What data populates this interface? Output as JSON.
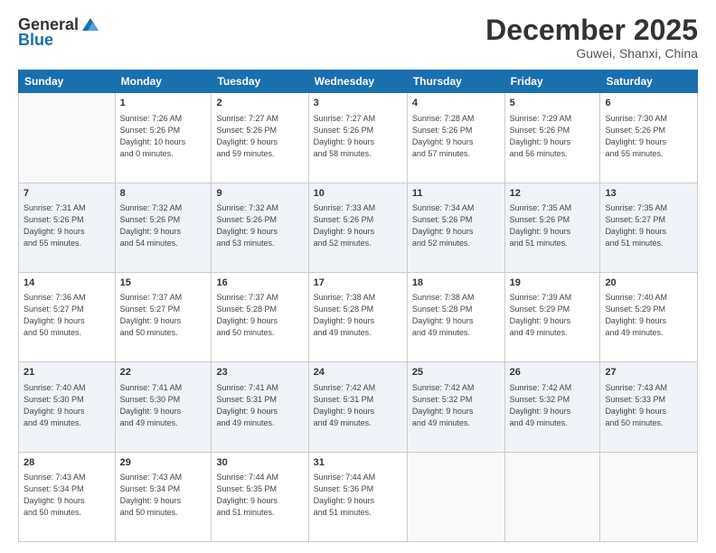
{
  "logo": {
    "text1": "General",
    "text2": "Blue"
  },
  "header": {
    "month": "December 2025",
    "location": "Guwei, Shanxi, China"
  },
  "weekdays": [
    "Sunday",
    "Monday",
    "Tuesday",
    "Wednesday",
    "Thursday",
    "Friday",
    "Saturday"
  ],
  "weeks": [
    [
      {
        "day": "",
        "info": ""
      },
      {
        "day": "1",
        "info": "Sunrise: 7:26 AM\nSunset: 5:26 PM\nDaylight: 10 hours\nand 0 minutes."
      },
      {
        "day": "2",
        "info": "Sunrise: 7:27 AM\nSunset: 5:26 PM\nDaylight: 9 hours\nand 59 minutes."
      },
      {
        "day": "3",
        "info": "Sunrise: 7:27 AM\nSunset: 5:26 PM\nDaylight: 9 hours\nand 58 minutes."
      },
      {
        "day": "4",
        "info": "Sunrise: 7:28 AM\nSunset: 5:26 PM\nDaylight: 9 hours\nand 57 minutes."
      },
      {
        "day": "5",
        "info": "Sunrise: 7:29 AM\nSunset: 5:26 PM\nDaylight: 9 hours\nand 56 minutes."
      },
      {
        "day": "6",
        "info": "Sunrise: 7:30 AM\nSunset: 5:26 PM\nDaylight: 9 hours\nand 55 minutes."
      }
    ],
    [
      {
        "day": "7",
        "info": "Sunrise: 7:31 AM\nSunset: 5:26 PM\nDaylight: 9 hours\nand 55 minutes."
      },
      {
        "day": "8",
        "info": "Sunrise: 7:32 AM\nSunset: 5:26 PM\nDaylight: 9 hours\nand 54 minutes."
      },
      {
        "day": "9",
        "info": "Sunrise: 7:32 AM\nSunset: 5:26 PM\nDaylight: 9 hours\nand 53 minutes."
      },
      {
        "day": "10",
        "info": "Sunrise: 7:33 AM\nSunset: 5:26 PM\nDaylight: 9 hours\nand 52 minutes."
      },
      {
        "day": "11",
        "info": "Sunrise: 7:34 AM\nSunset: 5:26 PM\nDaylight: 9 hours\nand 52 minutes."
      },
      {
        "day": "12",
        "info": "Sunrise: 7:35 AM\nSunset: 5:26 PM\nDaylight: 9 hours\nand 51 minutes."
      },
      {
        "day": "13",
        "info": "Sunrise: 7:35 AM\nSunset: 5:27 PM\nDaylight: 9 hours\nand 51 minutes."
      }
    ],
    [
      {
        "day": "14",
        "info": "Sunrise: 7:36 AM\nSunset: 5:27 PM\nDaylight: 9 hours\nand 50 minutes."
      },
      {
        "day": "15",
        "info": "Sunrise: 7:37 AM\nSunset: 5:27 PM\nDaylight: 9 hours\nand 50 minutes."
      },
      {
        "day": "16",
        "info": "Sunrise: 7:37 AM\nSunset: 5:28 PM\nDaylight: 9 hours\nand 50 minutes."
      },
      {
        "day": "17",
        "info": "Sunrise: 7:38 AM\nSunset: 5:28 PM\nDaylight: 9 hours\nand 49 minutes."
      },
      {
        "day": "18",
        "info": "Sunrise: 7:38 AM\nSunset: 5:28 PM\nDaylight: 9 hours\nand 49 minutes."
      },
      {
        "day": "19",
        "info": "Sunrise: 7:39 AM\nSunset: 5:29 PM\nDaylight: 9 hours\nand 49 minutes."
      },
      {
        "day": "20",
        "info": "Sunrise: 7:40 AM\nSunset: 5:29 PM\nDaylight: 9 hours\nand 49 minutes."
      }
    ],
    [
      {
        "day": "21",
        "info": "Sunrise: 7:40 AM\nSunset: 5:30 PM\nDaylight: 9 hours\nand 49 minutes."
      },
      {
        "day": "22",
        "info": "Sunrise: 7:41 AM\nSunset: 5:30 PM\nDaylight: 9 hours\nand 49 minutes."
      },
      {
        "day": "23",
        "info": "Sunrise: 7:41 AM\nSunset: 5:31 PM\nDaylight: 9 hours\nand 49 minutes."
      },
      {
        "day": "24",
        "info": "Sunrise: 7:42 AM\nSunset: 5:31 PM\nDaylight: 9 hours\nand 49 minutes."
      },
      {
        "day": "25",
        "info": "Sunrise: 7:42 AM\nSunset: 5:32 PM\nDaylight: 9 hours\nand 49 minutes."
      },
      {
        "day": "26",
        "info": "Sunrise: 7:42 AM\nSunset: 5:32 PM\nDaylight: 9 hours\nand 49 minutes."
      },
      {
        "day": "27",
        "info": "Sunrise: 7:43 AM\nSunset: 5:33 PM\nDaylight: 9 hours\nand 50 minutes."
      }
    ],
    [
      {
        "day": "28",
        "info": "Sunrise: 7:43 AM\nSunset: 5:34 PM\nDaylight: 9 hours\nand 50 minutes."
      },
      {
        "day": "29",
        "info": "Sunrise: 7:43 AM\nSunset: 5:34 PM\nDaylight: 9 hours\nand 50 minutes."
      },
      {
        "day": "30",
        "info": "Sunrise: 7:44 AM\nSunset: 5:35 PM\nDaylight: 9 hours\nand 51 minutes."
      },
      {
        "day": "31",
        "info": "Sunrise: 7:44 AM\nSunset: 5:36 PM\nDaylight: 9 hours\nand 51 minutes."
      },
      {
        "day": "",
        "info": ""
      },
      {
        "day": "",
        "info": ""
      },
      {
        "day": "",
        "info": ""
      }
    ]
  ]
}
